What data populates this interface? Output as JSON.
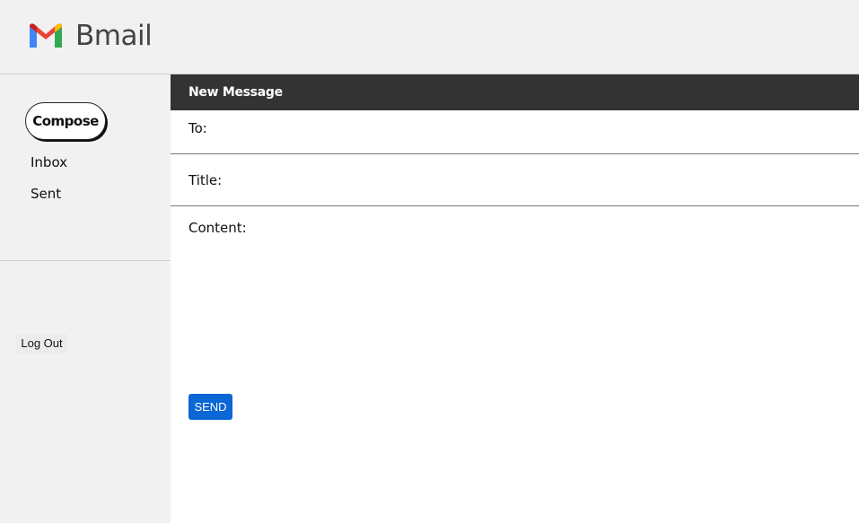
{
  "app": {
    "name": "Bmail",
    "logo_icon": "gmail-m-logo-icon"
  },
  "sidebar": {
    "compose_label": "Compose",
    "items": [
      {
        "label": "Inbox"
      },
      {
        "label": "Sent"
      }
    ],
    "logout_label": "Log Out"
  },
  "compose": {
    "header_title": "New Message",
    "to_label": "To:",
    "to_value": "",
    "title_label": "Title:",
    "title_value": "",
    "content_label": "Content:",
    "content_value": "",
    "send_label": "SEND"
  },
  "colors": {
    "header_bg": "#f1f1f1",
    "message_header_bg": "#333333",
    "send_button": "#0b66d6",
    "logo_red": "#ea4335",
    "logo_blue": "#4285f4",
    "logo_green": "#34a853",
    "logo_yellow": "#fbbc04"
  }
}
